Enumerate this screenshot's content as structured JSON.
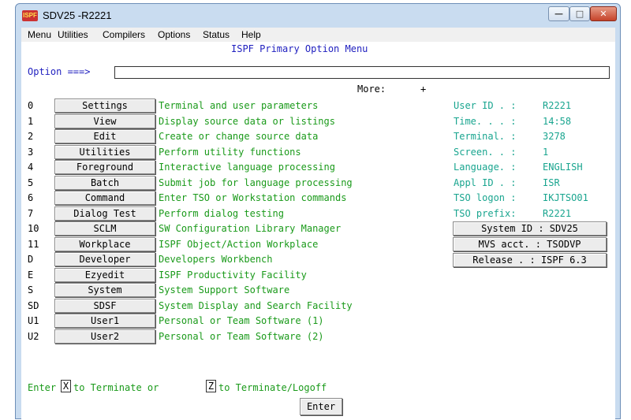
{
  "window": {
    "title": "SDV25 -R2221",
    "icon_label": "ISPF",
    "controls": {
      "minimize": "—",
      "maximize": "□",
      "close": "✕"
    }
  },
  "menubar": [
    "Menu",
    "Utilities",
    "Compilers",
    "Options",
    "Status",
    "Help"
  ],
  "panel": {
    "title": "ISPF Primary Option Menu",
    "option_prompt": "Option ===>",
    "option_value": "",
    "more_label": "More:",
    "more_indicator": "+"
  },
  "options": [
    {
      "code": "0",
      "label": "Settings",
      "desc": "Terminal and user parameters"
    },
    {
      "code": "1",
      "label": "View",
      "desc": "Display source data or listings"
    },
    {
      "code": "2",
      "label": "Edit",
      "desc": "Create or change source data"
    },
    {
      "code": "3",
      "label": "Utilities",
      "desc": "Perform utility functions"
    },
    {
      "code": "4",
      "label": "Foreground",
      "desc": "Interactive language processing"
    },
    {
      "code": "5",
      "label": "Batch",
      "desc": "Submit job for language processing"
    },
    {
      "code": "6",
      "label": "Command",
      "desc": "Enter TSO or Workstation commands"
    },
    {
      "code": "7",
      "label": "Dialog Test",
      "desc": "Perform dialog testing"
    },
    {
      "code": "10",
      "label": "SCLM",
      "desc": "SW Configuration Library Manager"
    },
    {
      "code": "11",
      "label": "Workplace",
      "desc": "ISPF Object/Action Workplace"
    },
    {
      "code": "D",
      "label": "Developer",
      "desc": "Developers Workbench"
    },
    {
      "code": "E",
      "label": "Ezyedit",
      "desc": "ISPF Productivity Facility"
    },
    {
      "code": "S",
      "label": "System",
      "desc": "System Support Software"
    },
    {
      "code": "SD",
      "label": "SDSF",
      "desc": "System Display and Search Facility"
    },
    {
      "code": "U1",
      "label": "User1",
      "desc": "Personal or Team Software (1)"
    },
    {
      "code": "U2",
      "label": "User2",
      "desc": "Personal or Team Software (2)"
    }
  ],
  "session_info": [
    {
      "label": "User ID . :",
      "value": "R2221"
    },
    {
      "label": "Time. . . :",
      "value": "14:58"
    },
    {
      "label": "Terminal. :",
      "value": "3278"
    },
    {
      "label": "Screen. . :",
      "value": "1"
    },
    {
      "label": "Language. :",
      "value": "ENGLISH"
    },
    {
      "label": "Appl ID . :",
      "value": "ISR"
    },
    {
      "label": "TSO logon :",
      "value": "IKJTSO01"
    },
    {
      "label": "TSO prefix:",
      "value": "R2221"
    }
  ],
  "info_buttons": [
    "System ID : SDV25",
    "MVS acct. : TSODVP",
    "Release . : ISPF 6.3"
  ],
  "footer": {
    "enter": "Enter",
    "x_key": "X",
    "mid": "to Terminate or",
    "z_key": "Z",
    "end": "to Terminate/Logoff",
    "enter_button": "Enter"
  },
  "colors": {
    "blue": "#1f1fbf",
    "green": "#1a9a1a",
    "teal": "#19a58f",
    "frame": "#c9dcf0"
  }
}
